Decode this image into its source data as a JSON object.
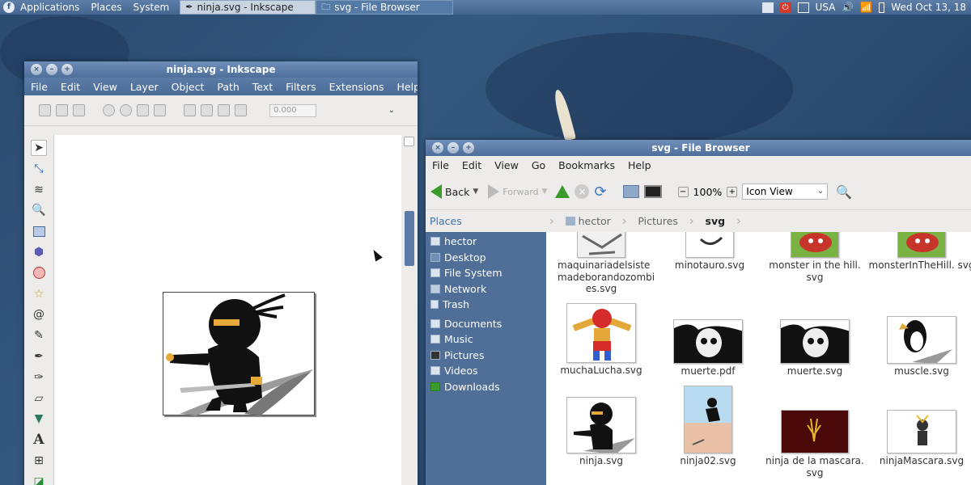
{
  "top_panel": {
    "menus": [
      "Applications",
      "Places",
      "System"
    ],
    "tasks": [
      {
        "label": "ninja.svg - Inkscape",
        "active": true
      },
      {
        "label": "svg - File Browser",
        "active": false
      }
    ],
    "keyboard_layout": "USA",
    "clock": "Wed Oct 13, 18"
  },
  "inkscape": {
    "title": "ninja.svg - Inkscape",
    "menu": [
      "File",
      "Edit",
      "View",
      "Layer",
      "Object",
      "Path",
      "Text",
      "Filters",
      "Extensions",
      "Help"
    ],
    "spin_value": "0.000",
    "tools": [
      "selector-icon",
      "node-icon",
      "tweak-icon",
      "zoom-icon",
      "rect-icon",
      "box3d-icon",
      "ellipse-icon",
      "star-icon",
      "spiral-icon",
      "pencil-icon",
      "pen-icon",
      "calligraphy-icon",
      "eraser-icon",
      "bucket-icon",
      "text-icon",
      "connector-icon",
      "gradient-icon"
    ]
  },
  "file_browser": {
    "title": "svg - File Browser",
    "menu": [
      "File",
      "Edit",
      "View",
      "Go",
      "Bookmarks",
      "Help"
    ],
    "toolbar": {
      "back": "Back",
      "forward": "Forward",
      "zoom": "100%",
      "view_mode": "Icon View"
    },
    "places_label": "Places",
    "breadcrumbs": [
      {
        "label": "hector",
        "current": false
      },
      {
        "label": "Pictures",
        "current": false
      },
      {
        "label": "svg",
        "current": true
      }
    ],
    "sidebar": [
      {
        "label": "hector",
        "icon": "home-icon"
      },
      {
        "label": "Desktop",
        "icon": "desktop-icon"
      },
      {
        "label": "File System",
        "icon": "drive-icon"
      },
      {
        "label": "Network",
        "icon": "network-icon"
      },
      {
        "label": "Trash",
        "icon": "trash-icon"
      },
      {
        "label": "Documents",
        "icon": "folder-icon"
      },
      {
        "label": "Music",
        "icon": "music-icon"
      },
      {
        "label": "Pictures",
        "icon": "pictures-icon"
      },
      {
        "label": "Videos",
        "icon": "videos-icon"
      },
      {
        "label": "Downloads",
        "icon": "downloads-icon"
      }
    ],
    "files": [
      {
        "name": "maquinariadelsiste madeborandozombi es.svg"
      },
      {
        "name": "minotauro.svg"
      },
      {
        "name": "monster in the hill. svg"
      },
      {
        "name": "monsterInTheHill. svg"
      },
      {
        "name": "muchaLucha.svg"
      },
      {
        "name": "muerte.pdf"
      },
      {
        "name": "muerte.svg"
      },
      {
        "name": "muscle.svg"
      },
      {
        "name": "ninja.svg"
      },
      {
        "name": "ninja02.svg"
      },
      {
        "name": "ninja de la mascara. svg"
      },
      {
        "name": "ninjaMascara.svg"
      }
    ]
  }
}
